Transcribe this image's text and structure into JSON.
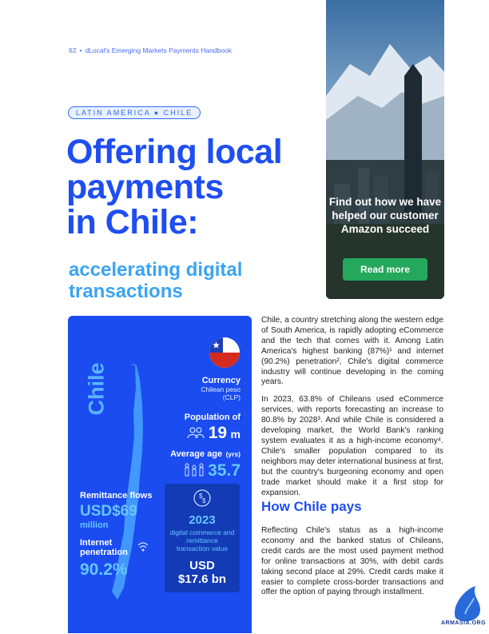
{
  "header": {
    "page_number": "62",
    "publication": "dLocal's Emerging Markets Payments Handbook"
  },
  "tag": "LATIN AMERICA ● CHILE",
  "title": {
    "line1": "Offering local",
    "line2": "payments",
    "line3": "in Chile:"
  },
  "subtitle": "accelerating digital transactions",
  "promo": {
    "text": "Find out how we have helped our customer Amazon succeed",
    "button": "Read more"
  },
  "panel": {
    "country": "Chile",
    "currency_label": "Currency",
    "currency_name": "Chilean peso",
    "currency_code": "(CLP)",
    "population_label": "Population of",
    "population_value": "19",
    "population_unit": "m",
    "age_label": "Average age",
    "age_unit": "(yrs)",
    "age_value": "35.7",
    "remittance_label": "Remittance flows",
    "remittance_value": "USD$69",
    "remittance_unit": "million",
    "internet_label_1": "Internet",
    "internet_label_2": "penetration",
    "internet_value": "90.2%",
    "box_year": "2023",
    "box_desc": "digital commerce and remittance transaction value",
    "box_currency": "USD",
    "box_value": "$17.6 bn"
  },
  "body": {
    "p1": "Chile, a country stretching along the western edge of South America, is rapidly adopting eCommerce and the tech that comes with it. Among Latin America's highest banking (87%)¹ and internet (90.2%) penetration², Chile's digital commerce industry will continue developing in the coming years.",
    "p2": "In 2023, 63.8% of Chileans used eCommerce services, with reports forecasting an increase to 80.8% by 2028³. And while Chile is considered a developing market, the World Bank's ranking system evaluates it as a high-income economy⁴. Chile's smaller population compared to its neighbors may deter international business at first, but the country's burgeoning economy and open trade market should make it a first stop for expansion.",
    "h2": "How Chile pays",
    "p3": "Reflecting Chile's status as a high-income economy and the banked status of Chileans, credit cards are the most used payment method for online transactions at 30%, with debit cards taking second place at 29%. Credit cards make it easier to complete cross-border transactions and offer the option of paying through installment."
  },
  "watermark": "ARMASIA.ORG",
  "colors": {
    "brand_blue": "#1f4ef0",
    "light_blue": "#3aa4f3",
    "panel_blue": "#1a4cf0",
    "button_green": "#23a85c"
  }
}
